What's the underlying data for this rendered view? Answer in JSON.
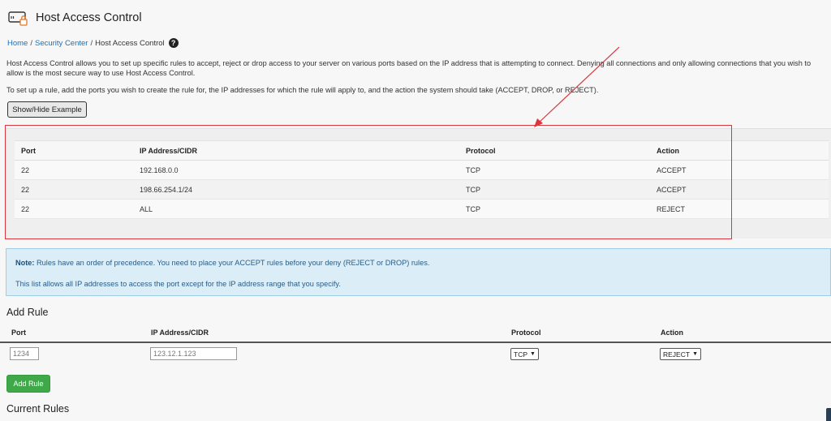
{
  "header": {
    "title": "Host Access Control",
    "icon": "host-access-icon"
  },
  "breadcrumb": {
    "home": "Home",
    "security_center": "Security Center",
    "current": "Host Access Control",
    "separator": "/"
  },
  "description": {
    "para1": "Host Access Control allows you to set up specific rules to accept, reject or drop access to your server on various ports based on the IP address that is attempting to connect. Denying all connections and only allowing connections that you wish to allow is the most secure way to use Host Access Control.",
    "para2": "To set up a rule, add the ports you wish to create the rule for, the IP addresses for which the rule will apply to, and the action the system should take (ACCEPT, DROP, or REJECT)."
  },
  "show_hide_button": "Show/Hide Example",
  "example_table": {
    "headers": [
      "Port",
      "IP Address/CIDR",
      "Protocol",
      "Action"
    ],
    "rows": [
      [
        "22",
        "192.168.0.0",
        "TCP",
        "ACCEPT"
      ],
      [
        "22",
        "198.66.254.1/24",
        "TCP",
        "ACCEPT"
      ],
      [
        "22",
        "ALL",
        "TCP",
        "REJECT"
      ]
    ]
  },
  "note": {
    "label": "Note:",
    "text": "Rules have an order of precedence. You need to place your ACCEPT rules before your deny (REJECT or DROP) rules.",
    "text2": "This list allows all IP addresses to access the port except for the IP address range that you specify."
  },
  "add_rule": {
    "title": "Add Rule",
    "headers": [
      "Port",
      "IP Address/CIDR",
      "Protocol",
      "Action"
    ],
    "port_placeholder": "1234",
    "ip_placeholder": "123.12.1.123",
    "protocol_value": "TCP",
    "action_value": "REJECT",
    "button": "Add Rule"
  },
  "current_rules": {
    "title": "Current Rules"
  },
  "colors": {
    "link": "#1d6fb5",
    "highlight": "#d9363e",
    "success": "#3fa94a",
    "note_bg": "#dbeef8"
  }
}
